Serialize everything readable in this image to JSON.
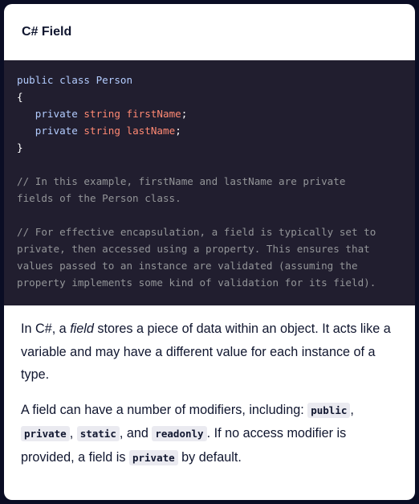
{
  "card": {
    "title": "C# Field"
  },
  "code": {
    "lines": [
      [
        {
          "t": "kw",
          "v": "public class Person"
        }
      ],
      [
        {
          "t": "pl",
          "v": "{"
        }
      ],
      [
        {
          "t": "pl",
          "v": "   "
        },
        {
          "t": "kw",
          "v": "private"
        },
        {
          "t": "pl",
          "v": " "
        },
        {
          "t": "ty",
          "v": "string"
        },
        {
          "t": "pl",
          "v": " "
        },
        {
          "t": "id",
          "v": "firstName"
        },
        {
          "t": "pl",
          "v": ";"
        }
      ],
      [
        {
          "t": "pl",
          "v": "   "
        },
        {
          "t": "kw",
          "v": "private"
        },
        {
          "t": "pl",
          "v": " "
        },
        {
          "t": "ty",
          "v": "string"
        },
        {
          "t": "pl",
          "v": " "
        },
        {
          "t": "id",
          "v": "lastName"
        },
        {
          "t": "pl",
          "v": ";"
        }
      ],
      [
        {
          "t": "pl",
          "v": "}"
        }
      ],
      [
        {
          "t": "pl",
          "v": ""
        }
      ],
      [
        {
          "t": "cm",
          "v": "// In this example, firstName and lastName are private"
        }
      ],
      [
        {
          "t": "cm",
          "v": "fields of the Person class."
        }
      ],
      [
        {
          "t": "pl",
          "v": ""
        }
      ],
      [
        {
          "t": "cm",
          "v": "// For effective encapsulation, a field is typically set to"
        }
      ],
      [
        {
          "t": "cm",
          "v": "private, then accessed using a property. This ensures that"
        }
      ],
      [
        {
          "t": "cm",
          "v": "values passed to an instance are validated (assuming the"
        }
      ],
      [
        {
          "t": "cm",
          "v": "property implements some kind of validation for its field)."
        }
      ]
    ]
  },
  "body": {
    "p1": {
      "before": "In C#, a ",
      "em": "field",
      "after": " stores a piece of data within an object. It acts like a variable and may have a different value for each instance of a type."
    },
    "p2": {
      "t1": "A field can have a number of modifiers, including: ",
      "c1": "public",
      "t2": ", ",
      "c2": "private",
      "t3": ", ",
      "c3": "static",
      "t4": ", and ",
      "c4": "readonly",
      "t5": ". If no access modifier is provided, a field is ",
      "c5": "private",
      "t6": " by default."
    }
  }
}
